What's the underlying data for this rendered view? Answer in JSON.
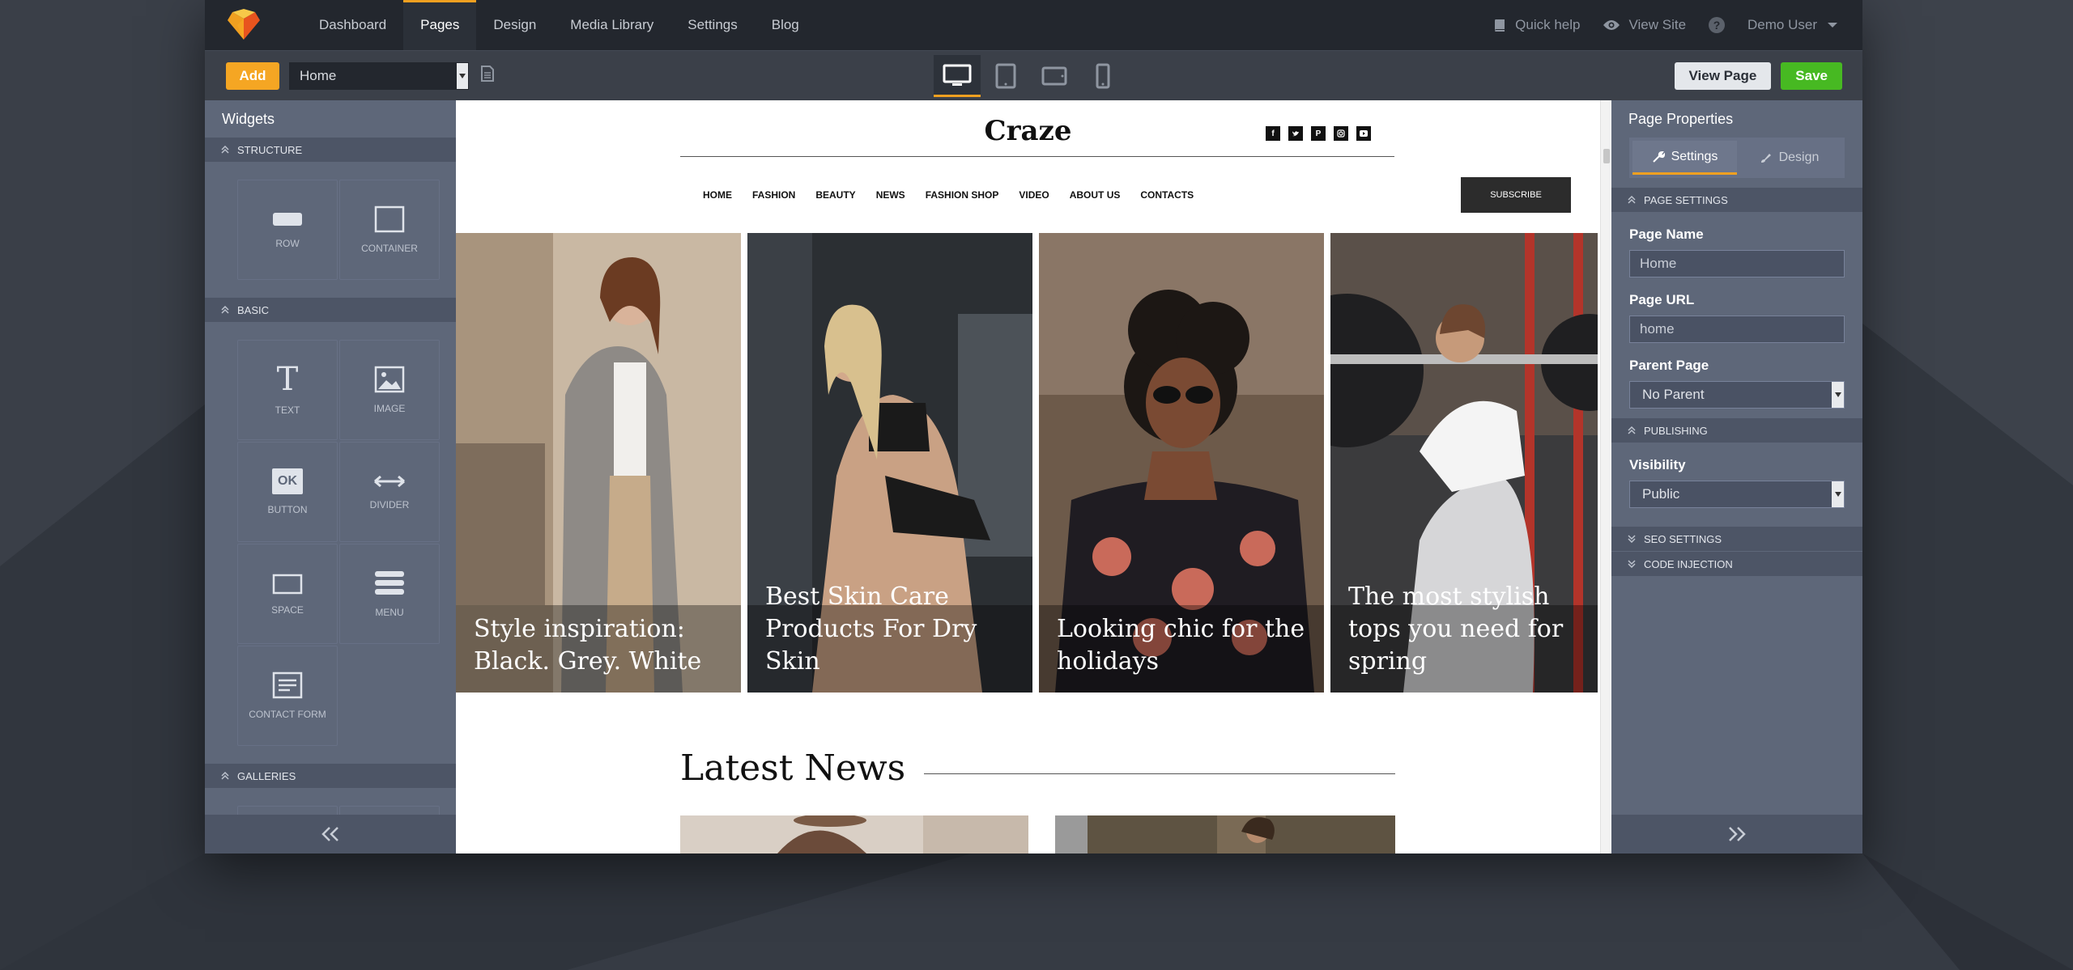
{
  "topnav": {
    "items": [
      "Dashboard",
      "Pages",
      "Design",
      "Media Library",
      "Settings",
      "Blog"
    ],
    "active_index": 1,
    "quick_help": "Quick help",
    "view_site": "View Site",
    "help_glyph": "?",
    "user": "Demo User"
  },
  "toolbar": {
    "add_label": "Add",
    "page_select_value": "Home",
    "view_page_label": "View Page",
    "save_label": "Save",
    "devices": [
      "desktop-icon",
      "tablet-icon",
      "tablet-landscape-icon",
      "mobile-icon"
    ],
    "active_device": "desktop-icon"
  },
  "widgets": {
    "title": "Widgets",
    "sections": [
      {
        "name": "STRUCTURE",
        "items": [
          "ROW",
          "CONTAINER"
        ]
      },
      {
        "name": "BASIC",
        "items": [
          "TEXT",
          "IMAGE",
          "BUTTON",
          "DIVIDER",
          "SPACE",
          "MENU",
          "CONTACT FORM"
        ]
      },
      {
        "name": "GALLERIES",
        "items": []
      }
    ],
    "button_glyph": "OK",
    "text_glyph": "T"
  },
  "site": {
    "brand": "Craze",
    "social_icons": [
      "facebook-icon",
      "twitter-icon",
      "pinterest-icon",
      "instagram-icon",
      "youtube-icon"
    ],
    "menu": [
      "HOME",
      "FASHION",
      "BEAUTY",
      "NEWS",
      "FASHION SHOP",
      "VIDEO",
      "ABOUT US",
      "CONTACTS"
    ],
    "subscribe": "SUBSCRIBE",
    "cards": [
      {
        "title": "Style inspiration: Black. Grey. White"
      },
      {
        "title": "Best Skin Care Products For Dry Skin"
      },
      {
        "title": "Looking chic for the holidays"
      },
      {
        "title": "The most stylish tops you need for spring"
      }
    ],
    "latest_news": "Latest News"
  },
  "properties": {
    "title": "Page Properties",
    "tabs": [
      "Settings",
      "Design"
    ],
    "active_tab": "Settings",
    "sections": {
      "page_settings": "PAGE SETTINGS",
      "publishing": "PUBLISHING",
      "seo": "SEO SETTINGS",
      "code": "CODE INJECTION"
    },
    "page_name_label": "Page Name",
    "page_name_value": "Home",
    "page_url_label": "Page URL",
    "page_url_value": "home",
    "parent_label": "Parent Page",
    "parent_value": "No Parent",
    "visibility_label": "Visibility",
    "visibility_value": "Public"
  },
  "colors": {
    "accent": "#f0a020",
    "add_button": "#f5a623",
    "save_button": "#47b922",
    "panel": "#5e6779",
    "topbar": "#23272e"
  }
}
